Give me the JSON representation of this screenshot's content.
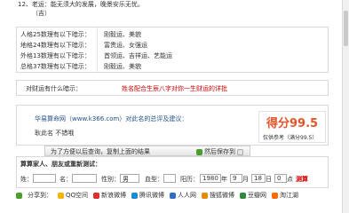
{
  "top": {
    "fortune_line": "12、老运：能无须大的发展，晚景安乐无忧。",
    "fortune_tag": "（吉）"
  },
  "metrics": [
    {
      "label": "人格25数理有以下暗示：",
      "value": "刚毅运、美貌"
    },
    {
      "label": "地格24数理有以下暗示：",
      "value": "富贵运、女强运"
    },
    {
      "label": "外格13数理有以下暗示：",
      "value": "首领运、吉祥运、艺能运"
    },
    {
      "label": "总格37数理有以下暗示：",
      "value": "刚毅运、美貌"
    }
  ],
  "tip": {
    "label": "对财运有什么暗示：",
    "link": "姓名配合生辰八字对你一生财运的详批"
  },
  "summary": {
    "site_title": "华易算命网（www.k366.com）对此名的总评及建议：",
    "name_line": "耿此名 不错哦",
    "score_text": "得分99.5",
    "score_note": "仅供参考（满分99.5）"
  },
  "save_bar": {
    "text": "为了方便以后查询，复制上面的结果",
    "save_btn": "然后保存到"
  },
  "form": {
    "title": "算算家人、朋友或重新测试：",
    "surname_label": "姓：",
    "name_label": "名：",
    "gender_label": "性别：",
    "gender_value": "男",
    "blood_label": "血型：",
    "solar_label": "阳历：",
    "year": "1980",
    "year_unit": "年",
    "month": "9",
    "month_unit": "月",
    "day": "18",
    "day_unit": "日",
    "hour": "0",
    "hour_unit": "点",
    "submit": "测算"
  },
  "share": {
    "label": "分享到：",
    "items": [
      {
        "label": "QQ空间",
        "color": "#f5b400"
      },
      {
        "label": "新浪微博",
        "color": "#e02d2d"
      },
      {
        "label": "腾讯微博",
        "color": "#1c8bd6"
      },
      {
        "label": "人人网",
        "color": "#2f6fc1"
      },
      {
        "label": "搜狐微博",
        "color": "#e68a00"
      },
      {
        "label": "豆瓣网",
        "color": "#2d8a3a"
      },
      {
        "label": "淘江湖",
        "color": "#ff6a00"
      }
    ]
  }
}
